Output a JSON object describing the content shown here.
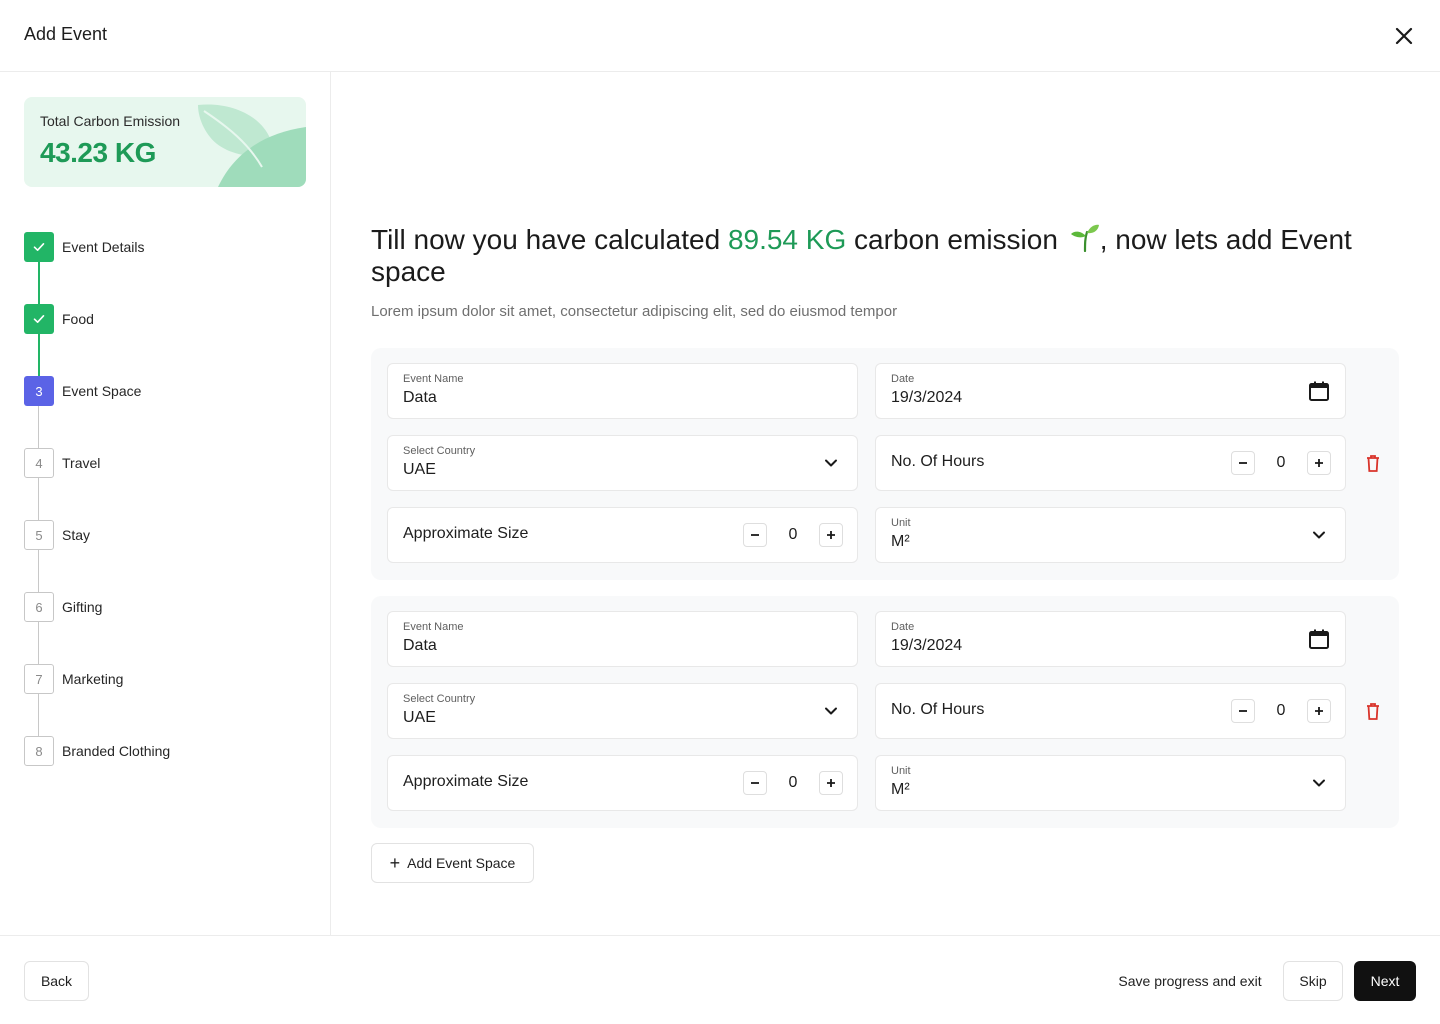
{
  "header": {
    "title": "Add Event",
    "close_icon": "close-icon"
  },
  "sidebar": {
    "emission_card": {
      "label": "Total Carbon Emission",
      "value": "43.23 KG"
    },
    "steps": [
      {
        "number": "1",
        "label": "Event Details",
        "status": "done"
      },
      {
        "number": "2",
        "label": "Food",
        "status": "done"
      },
      {
        "number": "3",
        "label": "Event Space",
        "status": "active"
      },
      {
        "number": "4",
        "label": "Travel",
        "status": "todo"
      },
      {
        "number": "5",
        "label": "Stay",
        "status": "todo"
      },
      {
        "number": "6",
        "label": "Gifting",
        "status": "todo"
      },
      {
        "number": "7",
        "label": "Marketing",
        "status": "todo"
      },
      {
        "number": "8",
        "label": "Branded Clothing",
        "status": "todo"
      }
    ]
  },
  "main": {
    "headline": {
      "before": "Till now you have calculated ",
      "highlight": "89.54 KG",
      "after": " carbon emission",
      "after_icon": ", now lets add Event space"
    },
    "subtext": "Lorem ipsum dolor sit amet, consectetur adipiscing elit, sed do eiusmod tempor",
    "event_spaces": [
      {
        "event_name": {
          "label": "Event Name",
          "value": "Data"
        },
        "date": {
          "label": "Date",
          "value": "19/3/2024"
        },
        "country": {
          "label": "Select Country",
          "value": "UAE"
        },
        "hours": {
          "label": "No. Of Hours",
          "value": "0"
        },
        "size": {
          "label": "Approximate Size",
          "value": "0"
        },
        "unit": {
          "label": "Unit",
          "value": "M²"
        }
      },
      {
        "event_name": {
          "label": "Event Name",
          "value": "Data"
        },
        "date": {
          "label": "Date",
          "value": "19/3/2024"
        },
        "country": {
          "label": "Select Country",
          "value": "UAE"
        },
        "hours": {
          "label": "No. Of Hours",
          "value": "0"
        },
        "size": {
          "label": "Approximate Size",
          "value": "0"
        },
        "unit": {
          "label": "Unit",
          "value": "M²"
        }
      }
    ],
    "add_button": "Add Event Space"
  },
  "footer": {
    "back": "Back",
    "save_exit": "Save progress and exit",
    "skip": "Skip",
    "next": "Next"
  },
  "colors": {
    "accent_green": "#1e9a57",
    "step_done": "#22b566",
    "step_active": "#5b63e6",
    "delete_red": "#d9342b",
    "primary_button": "#111111"
  }
}
